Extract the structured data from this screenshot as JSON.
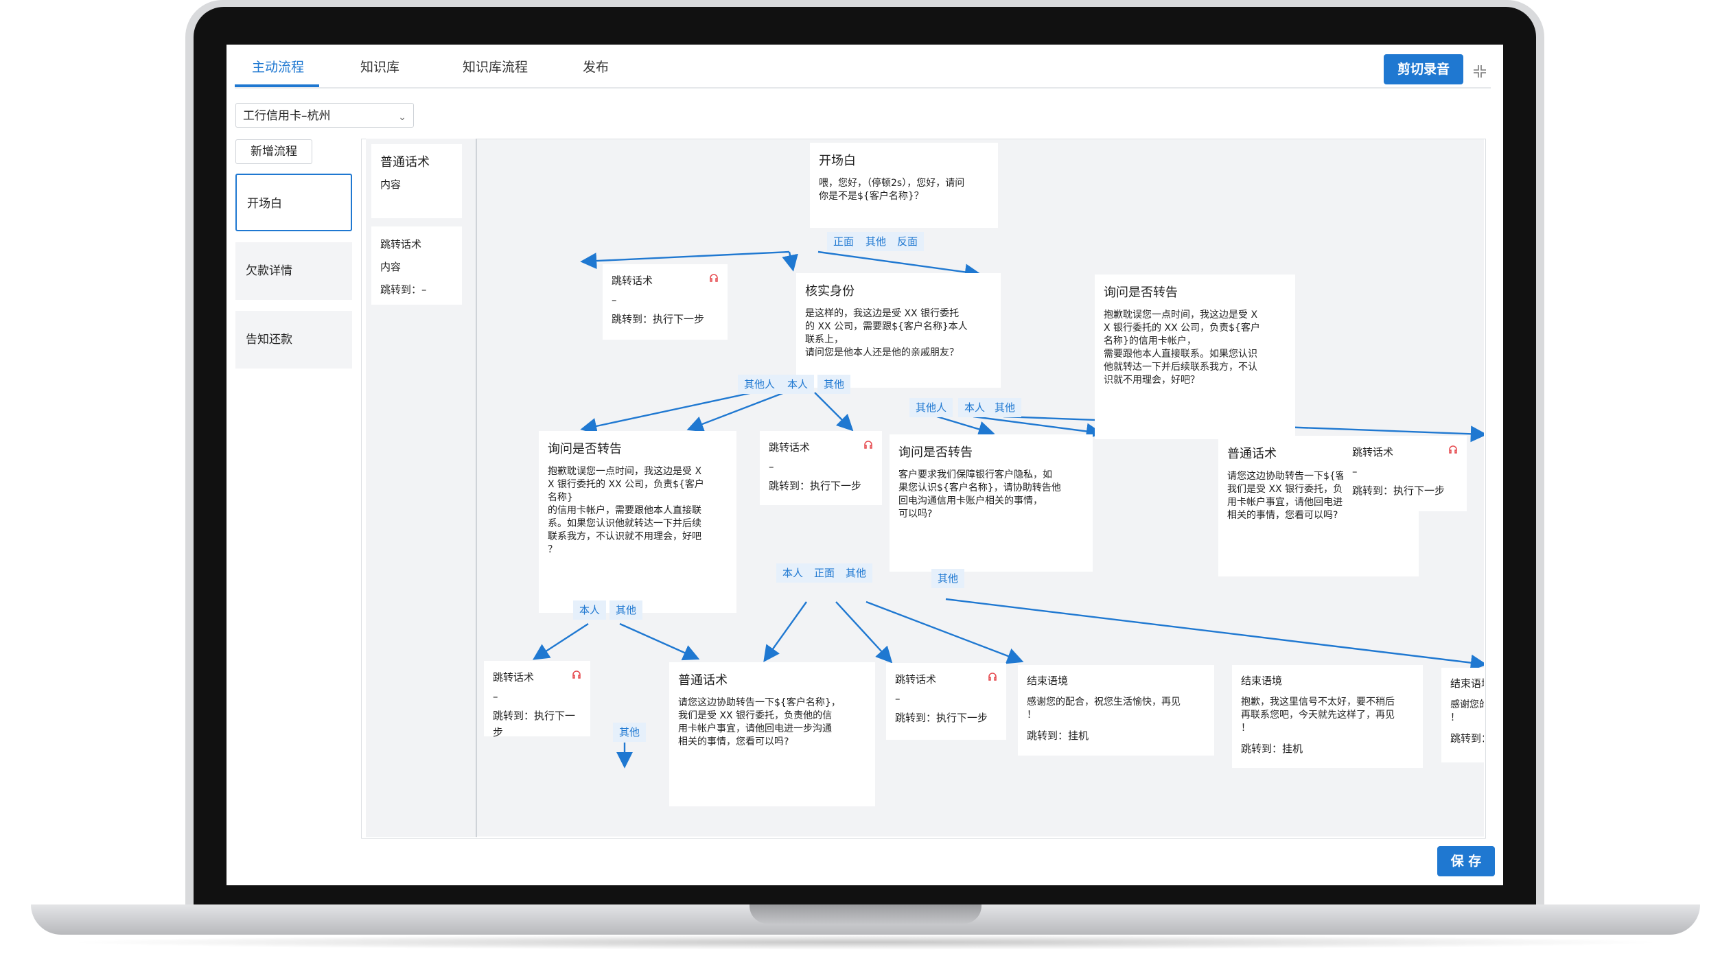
{
  "tabs": [
    "主动流程",
    "知识库",
    "知识库流程",
    "发布"
  ],
  "active_tab": "主动流程",
  "clip_button": "剪切录音",
  "save_button": "保 存",
  "project_select": "工行信用卡–杭州",
  "add_flow_button": "新增流程",
  "sidebar": [
    "开场白",
    "欠款详情",
    "告知还款"
  ],
  "palette": {
    "normal": {
      "title": "普通话术",
      "content": "内容"
    },
    "jump": {
      "title": "跳转话术",
      "content": "内容",
      "target": "跳转到：–"
    }
  },
  "nodes": {
    "opening": {
      "title": "开场白",
      "body": "喂，您好，（停顿2s），您好，请问\n你是不是${客户名称}？",
      "chips": [
        "正面",
        "其他",
        "反面"
      ]
    },
    "jump1": {
      "title": "跳转话术",
      "body": "–",
      "target": "跳转到：执行下一步"
    },
    "verify": {
      "title": "核实身份",
      "body": "是这样的，我这边是受 XX 银行委托\n的 XX 公司，需要跟${客户名称}本人\n联系上，\n请问您是他本人还是他的亲戚朋友？",
      "chips": [
        "其他人",
        "本人",
        "其他"
      ]
    },
    "ask_r": {
      "title": "询问是否转告",
      "body": "抱歉耽误您一点时间，我这边是受 X\nX 银行委托的 XX 公司，负责${客户\n名称}的信用卡帐户，\n需要跟他本人直接联系。如果您认识\n他就转达一下并后续联系我方，不认\n识就不用理会，好吧？",
      "chips": [
        "其他人",
        "本人",
        "其他"
      ]
    },
    "ask_l": {
      "title": "询问是否转告",
      "body": "抱歉耽误您一点时间，我这边是受 X\nX 银行委托的 XX 公司，负责${客户\n名称}\n的信用卡帐户，需要跟他本人直接联\n系。如果您认识他就转达一下并后续\n联系我方，不认识就不用理会，好吧\n？",
      "chips": [
        "本人",
        "其他"
      ]
    },
    "jump2": {
      "title": "跳转话术",
      "body": "–",
      "target": "跳转到：执行下一步"
    },
    "ask_m": {
      "title": "询问是否转告",
      "body": "客户要求我们保障银行客户隐私，如\n果您认识${客户名称}，请协助转告他\n回电沟通信用卡账户相关的事情，\n可以吗?",
      "chips": [
        "本人",
        "正面",
        "其他"
      ]
    },
    "normal_r": {
      "title": "普通话术",
      "body": "请您这边协助转告一下${客户名称}，\n我们是受 XX 银行委托，负责他的信\n用卡帐户事宜，请他回电进一步沟通\n相关的事情，您看可以吗?",
      "chips": [
        "其他"
      ]
    },
    "jump3": {
      "title": "跳转话术",
      "body": "–",
      "target": "跳转到：执行下一步"
    },
    "jump4": {
      "title": "跳转话术",
      "body": "–",
      "target": "跳转到：执行下一步"
    },
    "normal_l": {
      "title": "普通话术",
      "body": "请您这边协助转告一下${客户名称}，\n我们是受 XX 银行委托，负责他的信\n用卡帐户事宜，请他回电进一步沟通\n相关的事情，您看可以吗?",
      "chips": [
        "其他"
      ]
    },
    "jump5": {
      "title": "跳转话术",
      "body": "–",
      "target": "跳转到：执行下一步"
    },
    "end1": {
      "title": "结束语境",
      "body": "感谢您的配合，祝您生活愉快，再见\n！",
      "target": "跳转到：挂机"
    },
    "end2": {
      "title": "结束语境",
      "body": "抱歉，我这里信号不太好，要不稍后\n再联系您吧，今天就先这样了，再见\n！",
      "target": "跳转到：挂机"
    },
    "end3": {
      "title": "结束语境",
      "body": "感谢您的配合，祝\n！",
      "target": "跳转到：挂机"
    }
  },
  "colors": {
    "accent": "#1f78d1",
    "canvas": "#f2f3f5",
    "chip_bg": "#e6f0fb",
    "headset": "#e5484d"
  }
}
